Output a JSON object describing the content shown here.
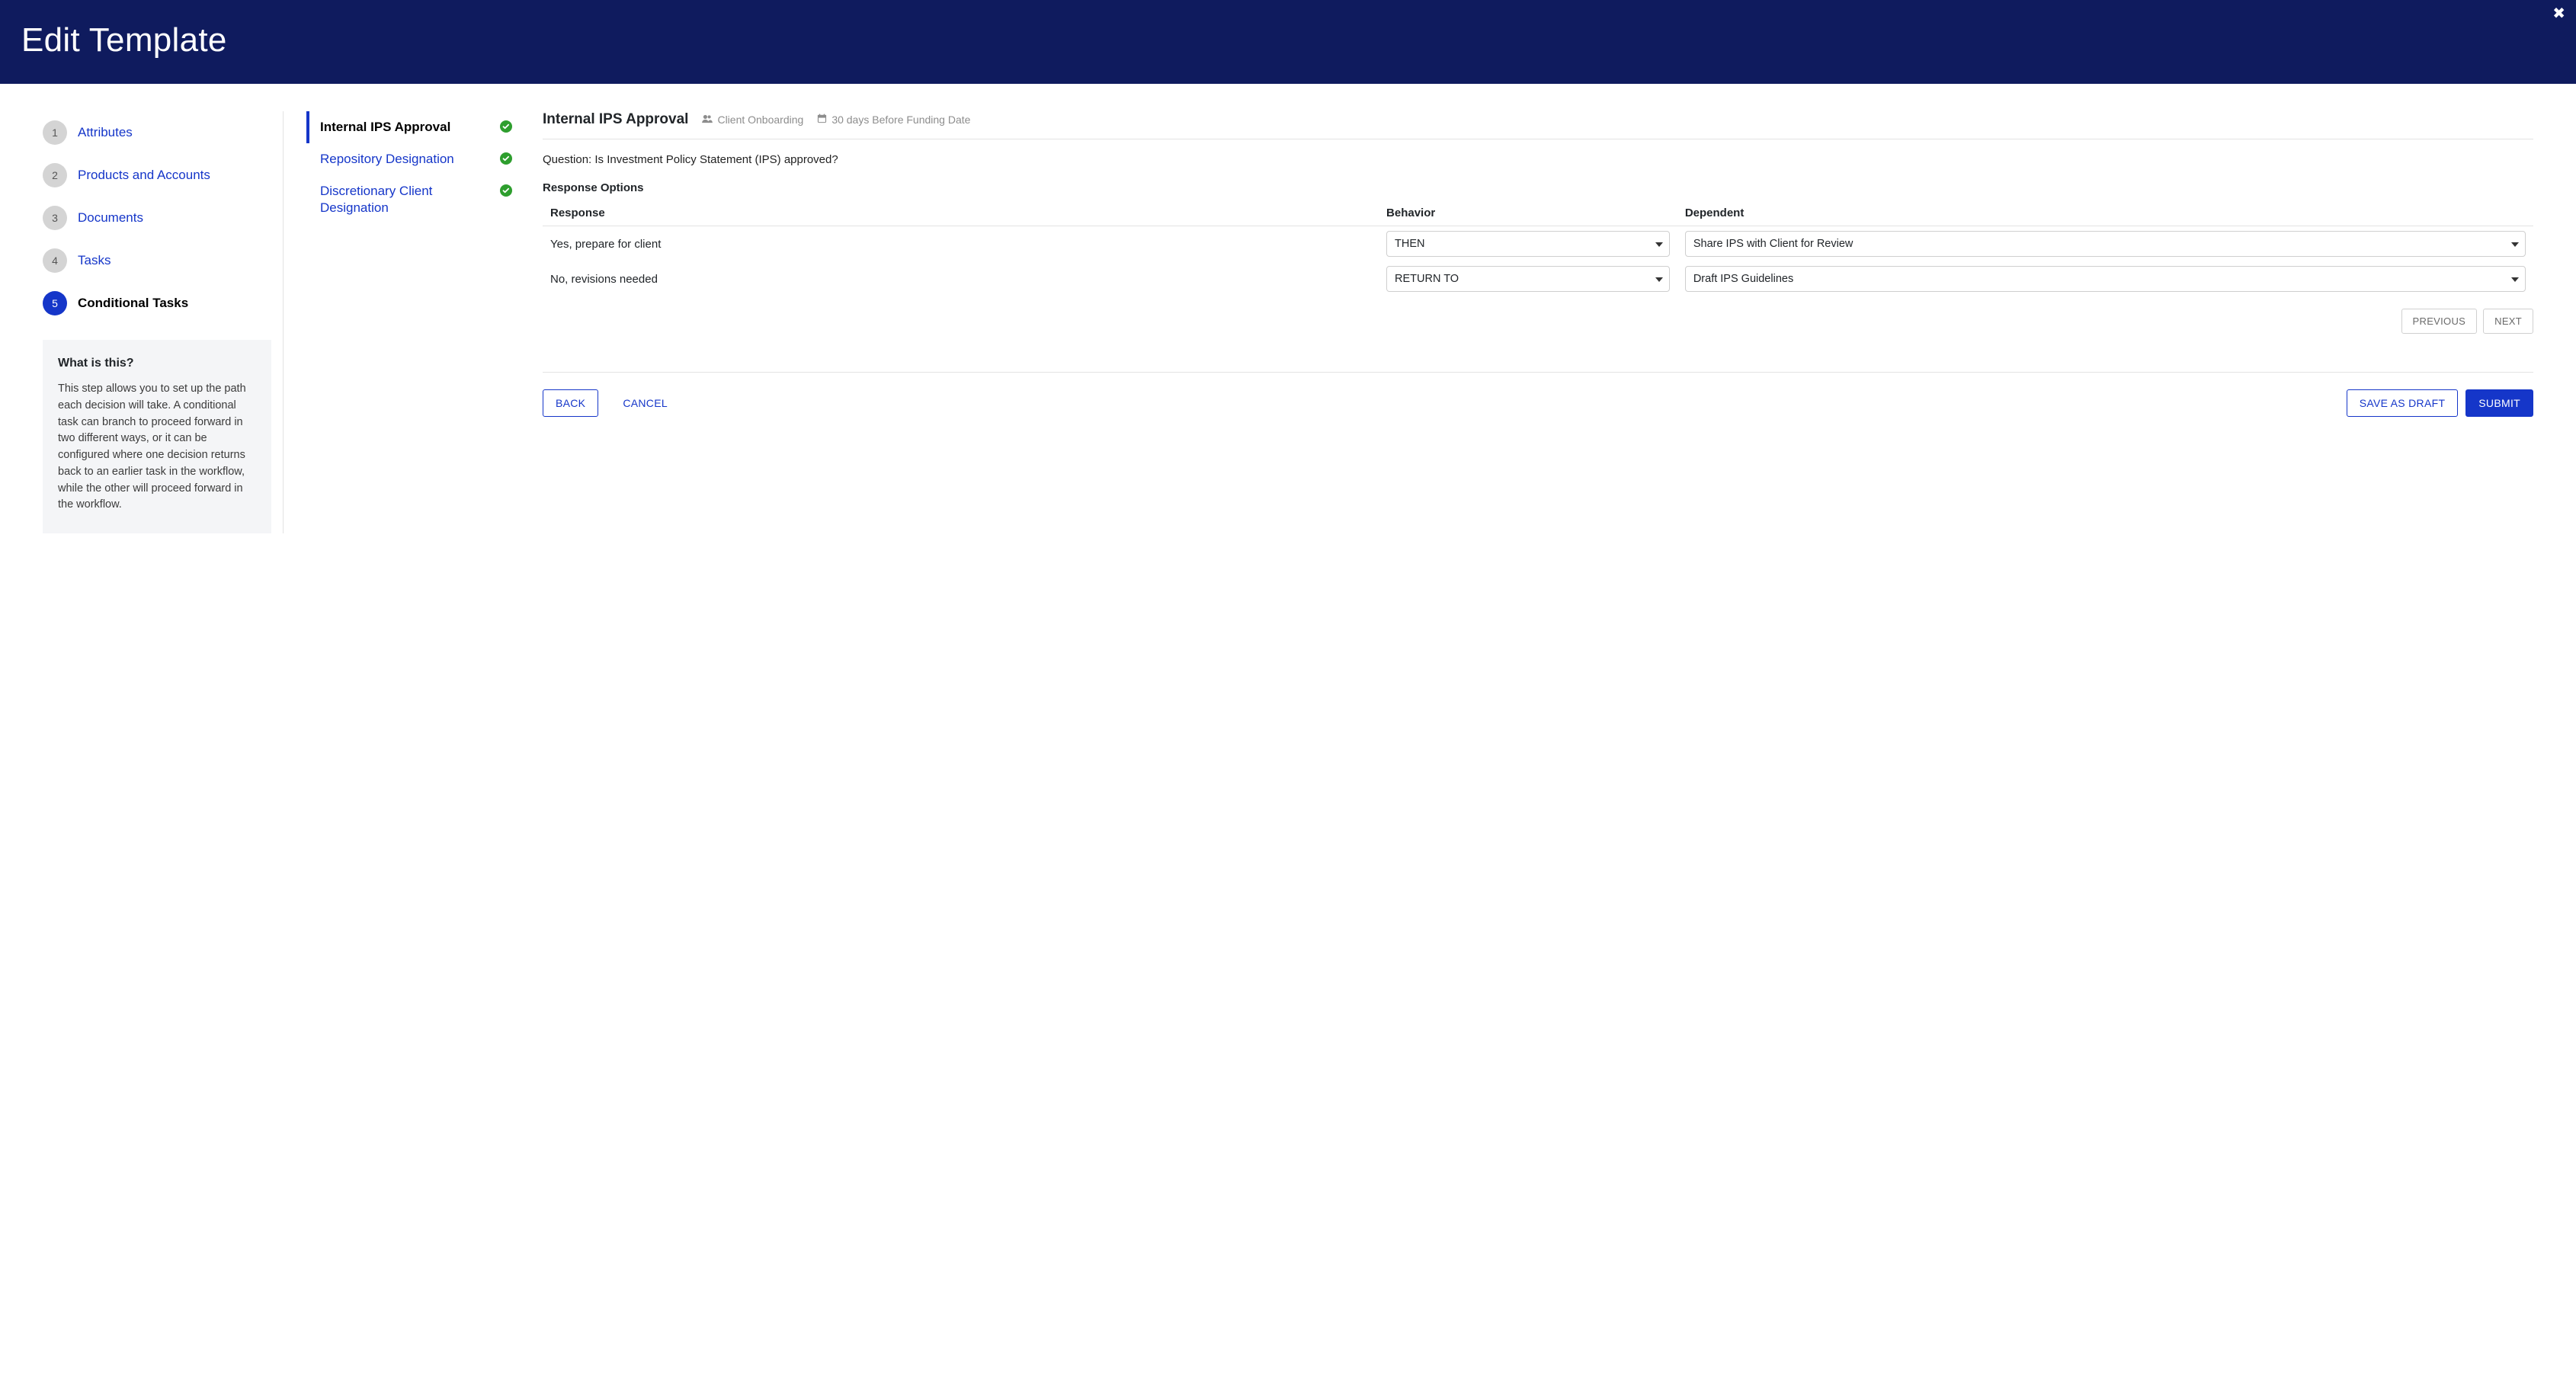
{
  "header": {
    "title": "Edit Template",
    "close_glyph": "✖"
  },
  "steps": [
    {
      "num": "1",
      "label": "Attributes",
      "active": false
    },
    {
      "num": "2",
      "label": "Products and Accounts",
      "active": false
    },
    {
      "num": "3",
      "label": "Documents",
      "active": false
    },
    {
      "num": "4",
      "label": "Tasks",
      "active": false
    },
    {
      "num": "5",
      "label": "Conditional Tasks",
      "active": true
    }
  ],
  "help": {
    "title": "What is this?",
    "body": "This step allows you to set up the path each decision will take. A conditional task can branch to proceed forward in two different ways, or it can be configured where one decision returns back to an earlier task in the workflow, while the other will proceed forward in the workflow."
  },
  "tasks": [
    {
      "label": "Internal IPS Approval",
      "selected": true,
      "complete": true
    },
    {
      "label": "Repository Designation",
      "selected": false,
      "complete": true
    },
    {
      "label": "Discretionary Client Designation",
      "selected": false,
      "complete": true
    }
  ],
  "detail": {
    "title": "Internal IPS Approval",
    "category": "Client Onboarding",
    "due": "30 days Before Funding Date",
    "question_label": "Question:",
    "question": "Is Investment Policy Statement (IPS) approved?",
    "response_header": "Response Options",
    "columns": {
      "response": "Response",
      "behavior": "Behavior",
      "dependent": "Dependent"
    },
    "rows": [
      {
        "response": "Yes, prepare for client",
        "behavior": "THEN",
        "dependent": "Share IPS with Client for Review"
      },
      {
        "response": "No, revisions needed",
        "behavior": "RETURN TO",
        "dependent": "Draft IPS Guidelines"
      }
    ],
    "pager": {
      "previous": "PREVIOUS",
      "next": "NEXT"
    }
  },
  "footer": {
    "back": "BACK",
    "cancel": "CANCEL",
    "save": "SAVE AS DRAFT",
    "submit": "SUBMIT"
  }
}
